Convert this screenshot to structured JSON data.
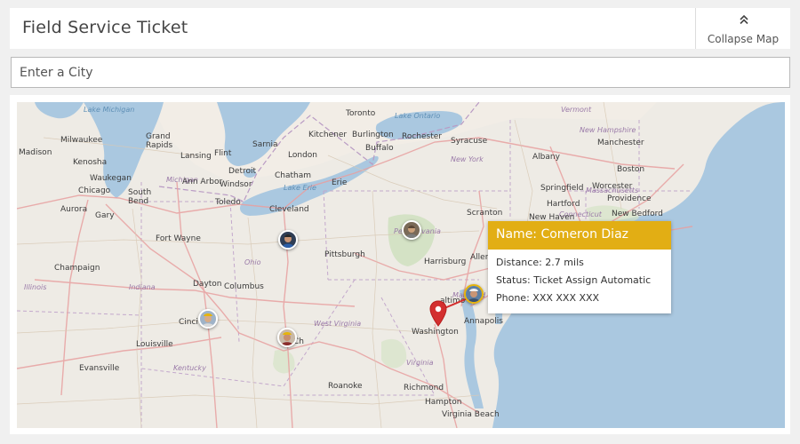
{
  "header": {
    "title": "Field Service Ticket",
    "collapse_label": "Collapse Map",
    "collapse_icon": "double-chevron-up-icon"
  },
  "search": {
    "placeholder": "Enter a City"
  },
  "map": {
    "cities": {
      "toronto": "Toronto",
      "kitchener": "Kitchener",
      "burlington": "Burlington",
      "rochester": "Rochester",
      "syracuse": "Syracuse",
      "buffalo": "Buffalo",
      "london": "London",
      "sarnia": "Sarnia",
      "flint": "Flint",
      "lansing": "Lansing",
      "grand_rapids": "Grand\nRapids",
      "milwaukee": "Milwaukee",
      "madison": "Madison",
      "kenosha": "Kenosha",
      "waukegan": "Waukegan",
      "chicago": "Chicago",
      "south_bend": "South\nBend",
      "aurora": "Aurora",
      "gary": "Gary",
      "detroit": "Detroit",
      "windsor": "Windsor",
      "chatham": "Chatham",
      "ann_arbor": "Ann Arbor",
      "toledo": "Toledo",
      "erie": "Erie",
      "cleveland": "Cleveland",
      "fort_wayne": "Fort Wayne",
      "pittsburgh": "Pittsburgh",
      "harrisburg": "Harrisburg",
      "champaign": "Champaign",
      "dayton": "Dayton",
      "columbus": "Columbus",
      "cincinnati": "Cinci",
      "louisville": "Louisville",
      "evansville": "Evansville",
      "charleston": "Ch",
      "roanoke": "Roanoke",
      "richmond": "Richmond",
      "hampton": "Hampton",
      "virginia_beach": "Virginia Beach",
      "washington": "Washington",
      "baltimore": "altimo",
      "annapolis": "Annapolis",
      "allentown": "Allen",
      "scranton": "Scranton",
      "albany": "Albany",
      "springfield": "Springfield",
      "hartford": "Hartford",
      "new_haven": "New Haven",
      "new_bedford": "New Bedford",
      "boston": "Boston",
      "worcester": "Worcester",
      "manchester": "Manchester",
      "providence": "Providence"
    },
    "regions": {
      "michigan": "Michigan",
      "ohio": "Ohio",
      "indiana": "Indiana",
      "illinois": "Illinois",
      "west_virginia": "West Virginia",
      "kentucky": "Kentucky",
      "virginia": "Virginia",
      "pennsylvania": "Pennsylvania",
      "new_york": "New York",
      "vermont": "Vermont",
      "new_hampshire": "New Hampshire",
      "massachusetts": "Massachusetts",
      "connecticut": "Connecticut",
      "maryland": "Maryland"
    },
    "water": {
      "lake_michigan": "Lake Michigan",
      "lake_ontario": "Lake Ontario",
      "lake_erie": "Lake Erie"
    },
    "marker_color": "#d32f2f",
    "selected_color": "#e6b40b"
  },
  "popup": {
    "name": "Name: Comeron Diaz",
    "distance": "Distance: 2.7 mils",
    "status": "Status: Ticket Assign Automatic",
    "phone": "Phone: XXX XXX XXX",
    "header_color": "#e2ae14"
  }
}
